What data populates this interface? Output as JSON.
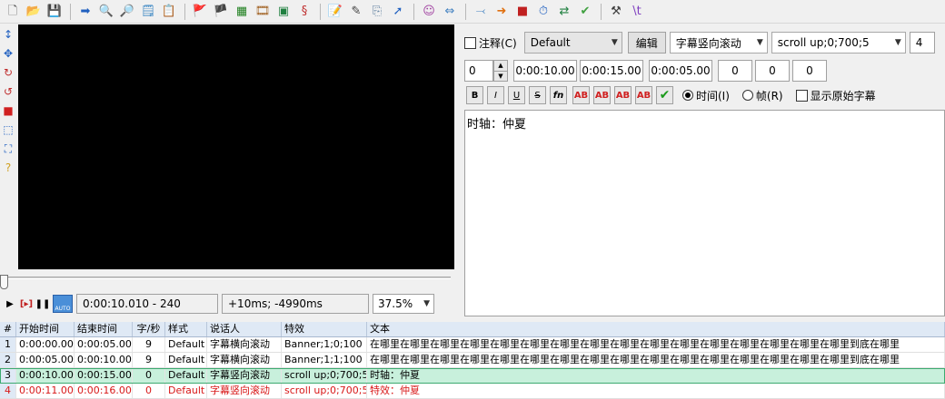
{
  "toolbar": {
    "icons": [
      "new-file-icon",
      "open-folder-icon",
      "save-icon",
      "jump-arrow-icon",
      "search-icon",
      "find-replace-icon",
      "style-manager-icon",
      "properties-icon",
      "flag-red-icon",
      "flag-blue-icon",
      "video-frames-icon",
      "film-icon",
      "keyframe-icon",
      "dollar-script-icon",
      "notepad-icon",
      "pen-icon",
      "copy-icon",
      "run-script-icon",
      "avatar-icon",
      "split-icon",
      "snap-icon",
      "arrow-right-icon",
      "stop-icon",
      "timer-icon",
      "translate-icon",
      "spellcheck-icon",
      "tools-icon",
      "tag-icon"
    ],
    "glyphs": [
      "🗋",
      "📂",
      "💾",
      "➡",
      "🔍",
      "🔎",
      "🗒",
      "📋",
      "🚩",
      "🏴",
      "▦",
      "🎞",
      "▣",
      "§",
      "📝",
      "✎",
      "⎘",
      "➚",
      "☺",
      "⇔",
      "⤙",
      "➜",
      "■",
      "⏱",
      "⇄",
      "✔",
      "⚒",
      "\\t"
    ]
  },
  "left_tools": {
    "glyphs": [
      "↕",
      "✥",
      "↻",
      "↺",
      "■",
      "⬚",
      "⛶",
      "?"
    ],
    "icons": [
      "standard-tool-icon",
      "drag-tool-icon",
      "rotate-z-icon",
      "rotate-xy-icon",
      "scale-tool-icon",
      "clip-rect-icon",
      "clip-vector-icon",
      "help-icon"
    ]
  },
  "playback": {
    "time_position": "0:00:10.010 - 240",
    "offset": "+10ms; -4990ms",
    "zoom": "37.5%",
    "auto_label": "AUTO"
  },
  "edit": {
    "comment_label": "注释(C)",
    "style": "Default",
    "edit_button": "编辑",
    "actor": "字幕竖向滚动",
    "effect": "scroll up;0;700;5",
    "effect_count": "4",
    "layer": "0",
    "start_time": "0:00:10.00",
    "end_time": "0:00:15.00",
    "duration": "0:00:05.00",
    "margin_l": "0",
    "margin_r": "0",
    "margin_v": "0",
    "bold": "B",
    "italic": "I",
    "underline": "U",
    "strike": "S",
    "font": "fn",
    "color_labels": [
      "AB",
      "AB",
      "AB",
      "AB"
    ],
    "colors": [
      "#d02020",
      "#d02020",
      "#d02020",
      "#d02020"
    ],
    "commit": "✔",
    "time_radio": "时间(I)",
    "frame_radio": "帧(R)",
    "show_original": "显示原始字幕",
    "text": "时轴：仲夏"
  },
  "grid": {
    "headers": [
      "#",
      "开始时间",
      "结束时间",
      "字/秒",
      "样式",
      "说话人",
      "特效",
      "文本"
    ],
    "rows": [
      {
        "num": "1",
        "start": "0:00:00.00",
        "end": "0:00:05.00",
        "cps": "9",
        "style": "Default",
        "actor": "字幕横向滚动",
        "effect": "Banner;1;0;100",
        "text": "在哪里在哪里在哪里在哪里在哪里在哪里在哪里在哪里在哪里在哪里在哪里在哪里在哪里在哪里在哪里在哪里到底在哪里"
      },
      {
        "num": "2",
        "start": "0:00:05.00",
        "end": "0:00:10.00",
        "cps": "9",
        "style": "Default",
        "actor": "字幕横向滚动",
        "effect": "Banner;1;1;100",
        "text": "在哪里在哪里在哪里在哪里在哪里在哪里在哪里在哪里在哪里在哪里在哪里在哪里在哪里在哪里在哪里在哪里到底在哪里"
      },
      {
        "num": "3",
        "start": "0:00:10.00",
        "end": "0:00:15.00",
        "cps": "0",
        "style": "Default",
        "actor": "字幕竖向滚动",
        "effect": "scroll up;0;700;5",
        "text": "时轴：仲夏"
      },
      {
        "num": "4",
        "start": "0:00:11.00",
        "end": "0:00:16.00",
        "cps": "0",
        "style": "Default",
        "actor": "字幕竖向滚动",
        "effect": "scroll up;0;700;5",
        "text": "特效：仲夏"
      }
    ],
    "selected_row_color": "#c8f0dc",
    "comment_row_color": "#d81818"
  }
}
